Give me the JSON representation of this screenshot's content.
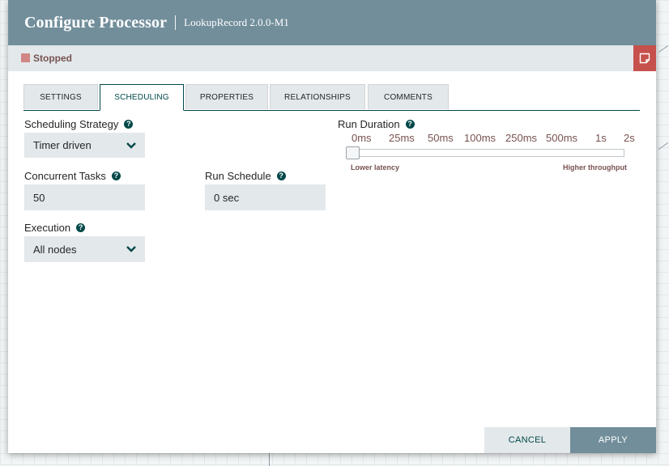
{
  "dialog": {
    "title": "Configure Processor",
    "subtitle": "LookupRecord 2.0.0-M1"
  },
  "status": {
    "label": "Stopped",
    "color": "#d18686"
  },
  "tabs": [
    {
      "label": "SETTINGS",
      "active": false
    },
    {
      "label": "SCHEDULING",
      "active": true
    },
    {
      "label": "PROPERTIES",
      "active": false
    },
    {
      "label": "RELATIONSHIPS",
      "active": false
    },
    {
      "label": "COMMENTS",
      "active": false
    }
  ],
  "scheduling": {
    "strategy": {
      "label": "Scheduling Strategy",
      "value": "Timer driven"
    },
    "concurrent_tasks": {
      "label": "Concurrent Tasks",
      "value": "50"
    },
    "run_schedule": {
      "label": "Run Schedule",
      "value": "0 sec"
    },
    "execution": {
      "label": "Execution",
      "value": "All nodes"
    },
    "run_duration": {
      "label": "Run Duration",
      "ticks": [
        "0ms",
        "25ms",
        "50ms",
        "100ms",
        "250ms",
        "500ms",
        "1s",
        "2s"
      ],
      "selected": "0ms",
      "low_caption": "Lower latency",
      "high_caption": "Higher throughput"
    }
  },
  "footer": {
    "cancel_label": "CANCEL",
    "apply_label": "APPLY"
  },
  "colors": {
    "header": "#728e9b",
    "accent": "#004849",
    "comments_button": "#c6504b"
  },
  "icons": {
    "help": "question-circle-icon",
    "dropdown": "chevron-down-icon",
    "comments": "sticky-note-icon"
  }
}
